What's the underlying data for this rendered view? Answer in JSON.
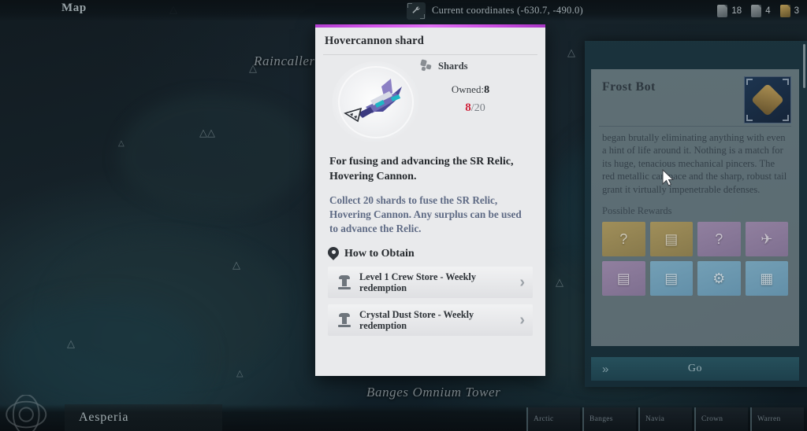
{
  "topbar": {
    "map_title": "Map",
    "coordinates_label": "Current coordinates (-630.7, -490.0)",
    "wrench_icon": "wrench-icon",
    "resources": [
      {
        "icon": "resource-scroll-icon",
        "value": "18"
      },
      {
        "icon": "resource-page-icon",
        "value": "4"
      },
      {
        "icon": "resource-gold-icon",
        "value": "3"
      }
    ]
  },
  "map": {
    "labels": [
      {
        "text": "Raincaller"
      },
      {
        "text": "Banges Omnium Tower"
      }
    ],
    "icon_name": "mountain-peak-icon"
  },
  "bottombar": {
    "region_name": "Aesperia",
    "crest_icon": "faction-crest-icon",
    "tabs": [
      {
        "label": "Arctic"
      },
      {
        "label": "Banges"
      },
      {
        "label": "Navia"
      },
      {
        "label": "Crown"
      },
      {
        "label": "Warren"
      }
    ]
  },
  "dialog": {
    "accent_color": "#d354ea",
    "title": "Hovercannon shard",
    "item_art_name": "hovercannon-ship-art",
    "shards": {
      "icon": "shards-icon",
      "label": "Shards",
      "owned_label": "Owned:",
      "owned_value": "8",
      "current": "8",
      "separator": "/",
      "required": "20",
      "current_color": "#d0243c"
    },
    "description_main": "For fusing and advancing the SR Relic, Hovering Cannon.",
    "description_sub": "Collect 20 shards to fuse the SR Relic, Hovering Cannon. Any surplus can be used to advance the Relic.",
    "obtain": {
      "pin_icon": "location-pin-icon",
      "heading": "How to Obtain",
      "rows": [
        {
          "icon": "store-tower-icon",
          "label": "Level 1 Crew Store - Weekly redemption",
          "chevron": "›"
        },
        {
          "icon": "store-tower-icon",
          "label": "Crystal Dust Store - Weekly redemption",
          "chevron": "›"
        }
      ]
    }
  },
  "right_panel": {
    "title": "Frost Bot",
    "portrait_name": "frost-bot-portrait",
    "description": "began brutally eliminating anything with even a hint of life around it. Nothing is a match for its huge, tenacious mechanical pincers. The red metallic carapace and the sharp, robust tail grant it virtually impenetrable defenses.",
    "rewards_title": "Possible Rewards",
    "rewards": [
      {
        "name": "reward-weapon-unknown",
        "tier": "rw-gold",
        "glyph": "?"
      },
      {
        "name": "reward-card-gold",
        "tier": "rw-gold",
        "glyph": "▤"
      },
      {
        "name": "reward-weapon-unknown-purple",
        "tier": "rw-purple",
        "glyph": "?"
      },
      {
        "name": "reward-craft-purple",
        "tier": "rw-purple",
        "glyph": "✈"
      },
      {
        "name": "reward-card-purple",
        "tier": "rw-purple",
        "glyph": "▤"
      },
      {
        "name": "reward-card-blue",
        "tier": "rw-blue",
        "glyph": "▤"
      },
      {
        "name": "reward-gear-blue",
        "tier": "rw-blue",
        "glyph": "⚙"
      },
      {
        "name": "reward-device-blue",
        "tier": "rw-blue",
        "glyph": "▦"
      }
    ],
    "go_label": "Go",
    "go_chevron": "»"
  }
}
